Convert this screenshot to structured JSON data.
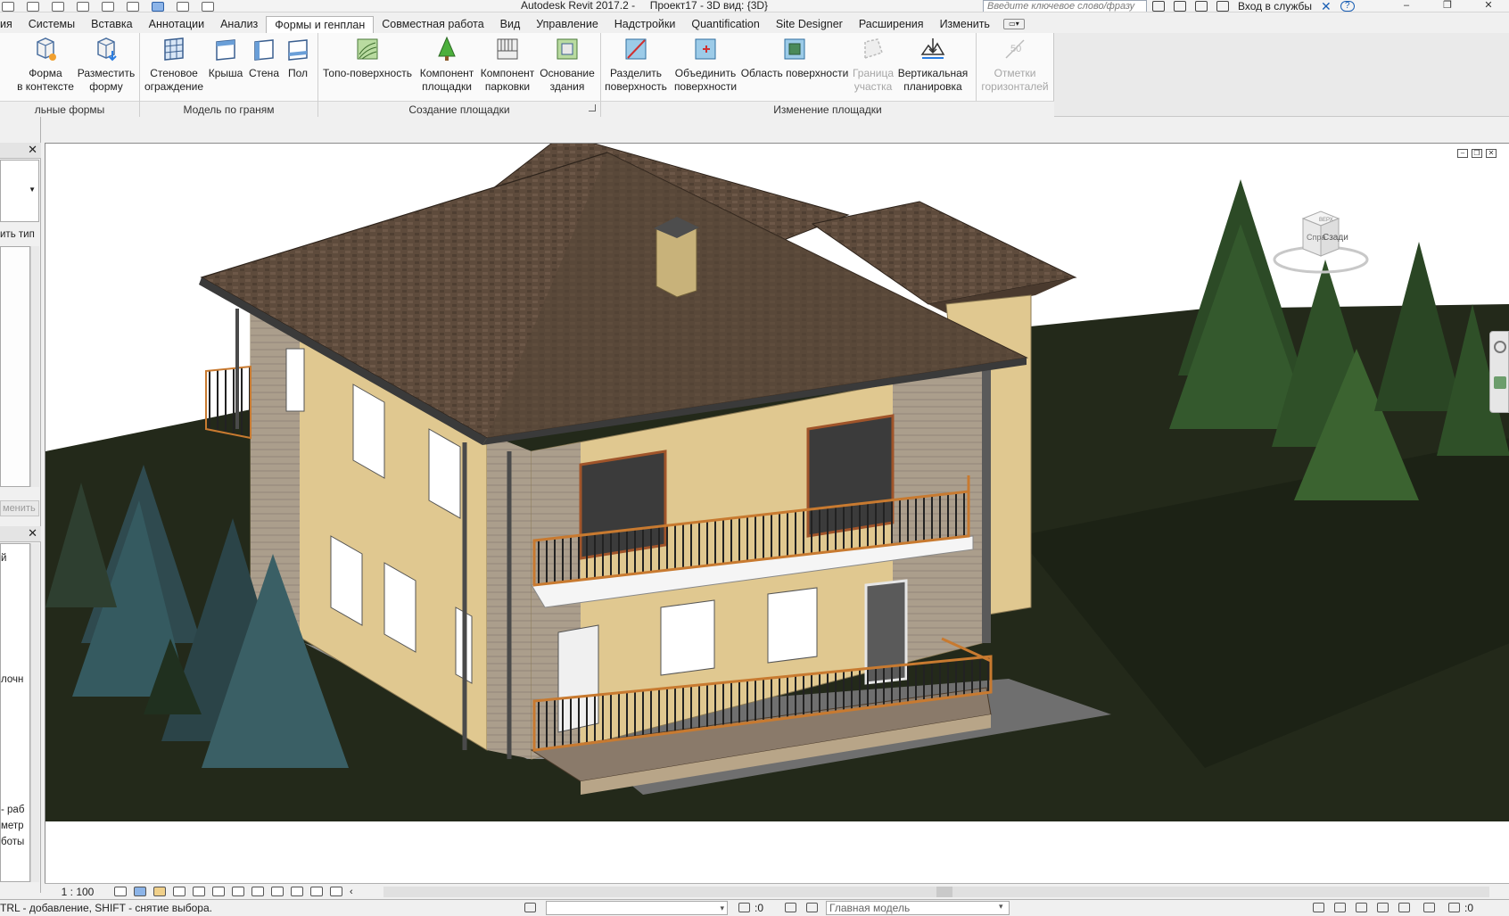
{
  "window": {
    "title": "Autodesk Revit 2017.2 -     Проект17 - 3D вид: {3D}",
    "search_placeholder": "Введите ключевое слово/фразу",
    "signin_label": "Вход в службы"
  },
  "tabs": [
    {
      "label": "ия",
      "active": false
    },
    {
      "label": "Системы",
      "active": false
    },
    {
      "label": "Вставка",
      "active": false
    },
    {
      "label": "Аннотации",
      "active": false
    },
    {
      "label": "Анализ",
      "active": false
    },
    {
      "label": "Формы и генплан",
      "active": true
    },
    {
      "label": "Совместная работа",
      "active": false
    },
    {
      "label": "Вид",
      "active": false
    },
    {
      "label": "Управление",
      "active": false
    },
    {
      "label": "Надстройки",
      "active": false
    },
    {
      "label": "Quantification",
      "active": false
    },
    {
      "label": "Site Designer",
      "active": false
    },
    {
      "label": "Расширения",
      "active": false
    },
    {
      "label": "Изменить",
      "active": false
    }
  ],
  "ribbon": {
    "buttons": [
      {
        "line1": "Форма",
        "line2": "в контексте",
        "icon": "inplace-mass-icon",
        "enabled": true
      },
      {
        "line1": "Разместить",
        "line2": "форму",
        "icon": "place-mass-icon",
        "enabled": true
      },
      {
        "line1": "Стеновое",
        "line2": "ограждение",
        "icon": "curtain-system-icon",
        "enabled": true
      },
      {
        "line1": "Крыша",
        "line2": "",
        "icon": "roof-by-face-icon",
        "enabled": true
      },
      {
        "line1": "Стена",
        "line2": "",
        "icon": "wall-by-face-icon",
        "enabled": true
      },
      {
        "line1": "Пол",
        "line2": "",
        "icon": "floor-by-face-icon",
        "enabled": true
      },
      {
        "line1": "Топо-поверхность",
        "line2": "",
        "icon": "toposurface-icon",
        "enabled": true
      },
      {
        "line1": "Компонент",
        "line2": "площадки",
        "icon": "site-component-icon",
        "enabled": true
      },
      {
        "line1": "Компонент",
        "line2": "парковки",
        "icon": "parking-component-icon",
        "enabled": true
      },
      {
        "line1": "Основание",
        "line2": "здания",
        "icon": "building-pad-icon",
        "enabled": true
      },
      {
        "line1": "Разделить",
        "line2": "поверхность",
        "icon": "split-surface-icon",
        "enabled": true
      },
      {
        "line1": "Объединить",
        "line2": "поверхности",
        "icon": "merge-surfaces-icon",
        "enabled": true
      },
      {
        "line1": "Область поверхности",
        "line2": "",
        "icon": "subregion-icon",
        "enabled": true
      },
      {
        "line1": "Граница",
        "line2": "участка",
        "icon": "property-line-icon",
        "enabled": false
      },
      {
        "line1": "Вертикальная",
        "line2": "планировка",
        "icon": "graded-region-icon",
        "enabled": true
      },
      {
        "line1": "Отметки",
        "line2": "горизонталей",
        "icon": "label-contours-icon",
        "enabled": false
      }
    ],
    "panels": [
      {
        "label": "льные формы"
      },
      {
        "label": "Модель по граням"
      },
      {
        "label": "Создание площадки"
      },
      {
        "label": "Изменение площадки"
      }
    ]
  },
  "left_panel": {
    "type_label": "ить тип",
    "edit_button": "менить",
    "text_1": "й",
    "text_2": "лочн",
    "text_3": "- раб",
    "text_4": "метр",
    "text_5": "боты"
  },
  "viewcube": {
    "face_left": "Спра",
    "face_right": "Сзади",
    "face_top": "ВЕРХ"
  },
  "view_bar": {
    "scale": "1 : 100"
  },
  "status_bar": {
    "hint": "TRL - добавление, SHIFT - снятие выбора.",
    "selection_count": ":0",
    "model_label": "Главная модель",
    "filter_count": ":0"
  },
  "colors": {
    "roof": "#5e4b3c",
    "wall_plaster": "#e0c890",
    "wall_siding": "#ab9e8c",
    "grass": "#23291a",
    "ribbon_bg": "#fafafa",
    "active_tab": "#ffffff"
  }
}
